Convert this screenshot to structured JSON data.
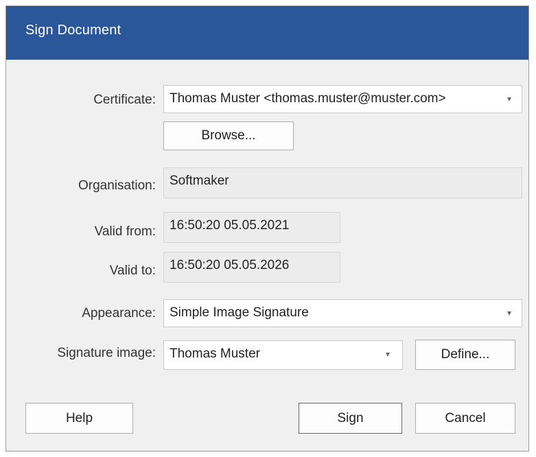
{
  "window": {
    "title": "Sign Document"
  },
  "certificate": {
    "label": "Certificate:",
    "value": "Thomas Muster <thomas.muster@muster.com>",
    "arrow": "▾"
  },
  "browse_label": "Browse...",
  "organisation": {
    "label": "Organisation:",
    "value": "Softmaker"
  },
  "valid_from": {
    "label": "Valid from:",
    "value": "16:50:20 05.05.2021"
  },
  "valid_to": {
    "label": "Valid to:",
    "value": "16:50:20 05.05.2026"
  },
  "appearance": {
    "label": "Appearance:",
    "value": "Simple Image Signature",
    "arrow": "▾"
  },
  "signature_image": {
    "label": "Signature image:",
    "value": "Thomas Muster",
    "arrow": "▾"
  },
  "define_label": "Define...",
  "buttons": {
    "help": "Help",
    "sign": "Sign",
    "cancel": "Cancel"
  },
  "colors": {
    "titlebar": "#2b579a",
    "primary_border": "#2b6fd6"
  }
}
